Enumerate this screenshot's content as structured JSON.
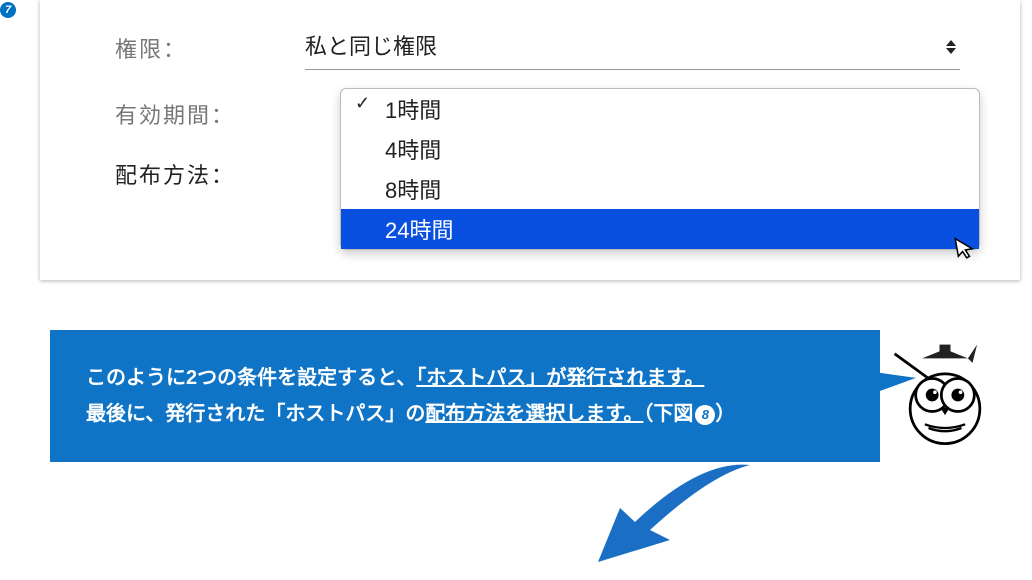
{
  "step_badge": "7",
  "form": {
    "permission_label": "権限：",
    "permission_value": "私と同じ権限",
    "duration_label": "有効期間：",
    "distribution_label": "配布方法："
  },
  "dropdown": {
    "options": [
      {
        "label": "1時間",
        "selected": true,
        "highlighted": false
      },
      {
        "label": "4時間",
        "selected": false,
        "highlighted": false
      },
      {
        "label": "8時間",
        "selected": false,
        "highlighted": false
      },
      {
        "label": "24時間",
        "selected": false,
        "highlighted": true
      }
    ]
  },
  "callout": {
    "line1_pre": "このように2つの条件を設定すると、",
    "line1_u": "「ホストパス」が発行されます。",
    "line2_pre": "最後に、発行された「ホストパス」の",
    "line2_u": "配布方法を選択します。",
    "line2_post": "（下図",
    "badge": "8",
    "close": "）"
  }
}
